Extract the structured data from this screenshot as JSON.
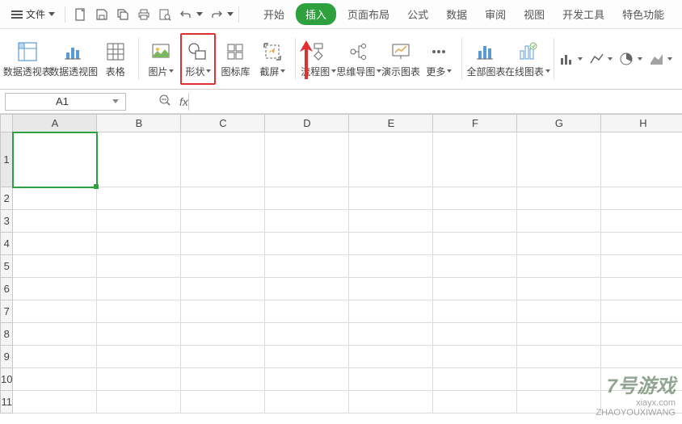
{
  "fileMenu": {
    "label": "文件"
  },
  "menuTabs": {
    "start": "开始",
    "insert": "插入",
    "pageLayout": "页面布局",
    "formula": "公式",
    "data": "数据",
    "review": "审阅",
    "view": "视图",
    "devTools": "开发工具",
    "features": "特色功能"
  },
  "ribbon": {
    "pivotTable": "数据透视表",
    "pivotChart": "数据透视图",
    "table": "表格",
    "picture": "图片",
    "shapes": "形状",
    "iconLib": "图标库",
    "screenshot": "截屏",
    "flowchart": "流程图",
    "mindmap": "思维导图",
    "presentChart": "演示图表",
    "more": "更多",
    "allCharts": "全部图表",
    "onlineCharts": "在线图表"
  },
  "cellRef": {
    "value": "A1"
  },
  "formulaBar": {
    "fxLabel": "fx"
  },
  "columns": [
    "A",
    "B",
    "C",
    "D",
    "E",
    "F",
    "G",
    "H"
  ],
  "rows": [
    "1",
    "2",
    "3",
    "4",
    "5",
    "6",
    "7",
    "8",
    "9",
    "10",
    "11"
  ],
  "watermark": {
    "logo": "7号游戏",
    "url1": "xiayx.com",
    "url2": "ZHAOYOUXIWANG"
  }
}
